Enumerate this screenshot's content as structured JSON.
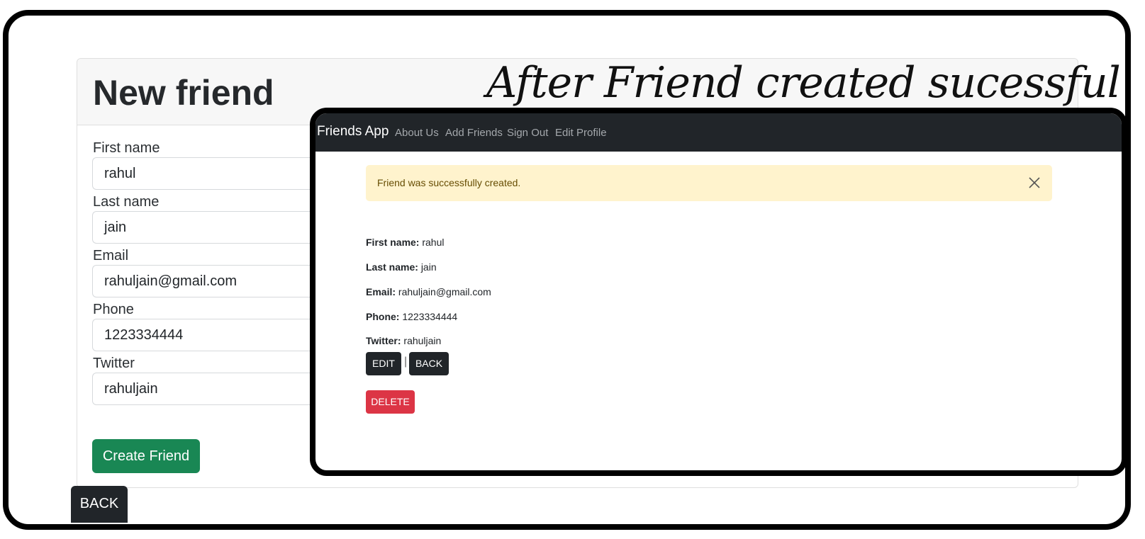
{
  "form": {
    "title": "New friend",
    "fields": [
      {
        "label": "First name",
        "value": "rahul"
      },
      {
        "label": "Last name",
        "value": "jain"
      },
      {
        "label": "Email",
        "value": "rahuljain@gmail.com"
      },
      {
        "label": "Phone",
        "value": "1223334444"
      },
      {
        "label": "Twitter",
        "value": "rahuljain"
      }
    ],
    "submit_label": "Create Friend",
    "back_label": "BACK"
  },
  "annotation": "After Friend created sucessful",
  "overlay": {
    "navbar": {
      "brand": "Friends App",
      "links": [
        "About Us",
        "Add Friends",
        "Sign Out",
        "Edit Profile"
      ]
    },
    "alert": {
      "message": "Friend was successfully created."
    },
    "details": [
      {
        "label": "First name:",
        "value": "rahul"
      },
      {
        "label": "Last name:",
        "value": "jain"
      },
      {
        "label": "Email:",
        "value": "rahuljain@gmail.com"
      },
      {
        "label": "Phone:",
        "value": "1223334444"
      },
      {
        "label": "Twitter:",
        "value": "rahuljain"
      }
    ],
    "edit_label": "EDIT",
    "separator": "|",
    "back_label": "BACK",
    "delete_label": "DELETE"
  },
  "colors": {
    "navbar": "#212529",
    "create_button": "#198754",
    "delete_button": "#dc3545",
    "alert_background": "#fff3cd"
  }
}
